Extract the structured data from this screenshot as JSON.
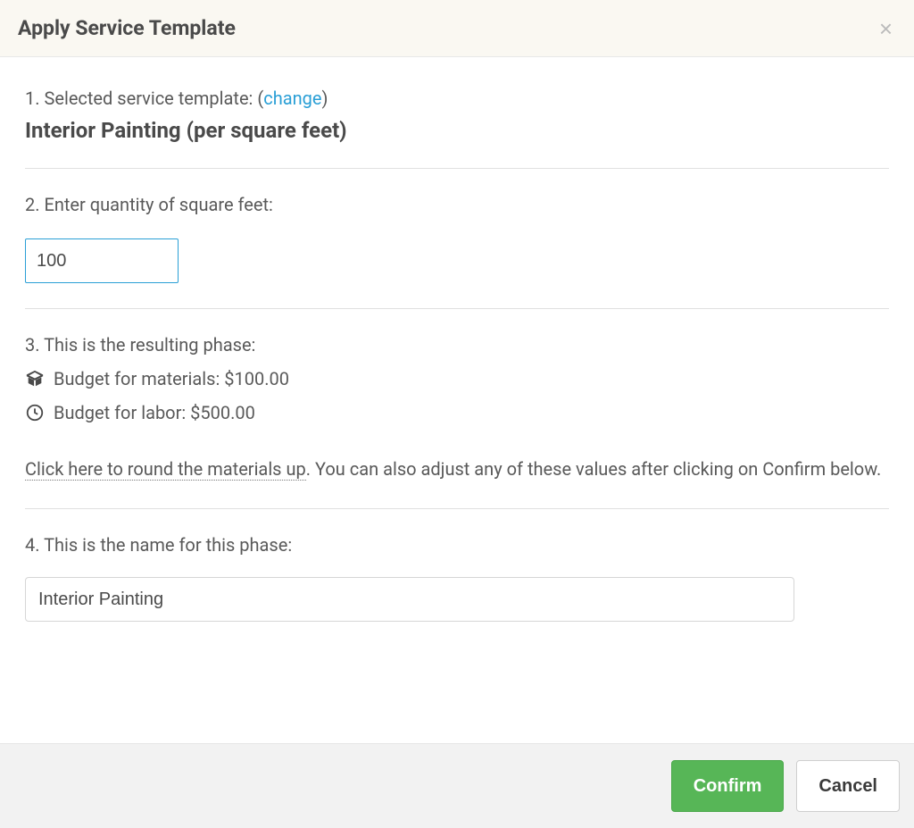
{
  "header": {
    "title": "Apply Service Template"
  },
  "step1": {
    "label_prefix": "1. Selected service template: (",
    "change_label": "change",
    "label_suffix": ")",
    "template_name": "Interior Painting (per square feet)"
  },
  "step2": {
    "label": "2. Enter quantity of square feet:",
    "value": "100"
  },
  "step3": {
    "label": "3. This is the resulting phase:",
    "materials_label": "Budget for materials: ",
    "materials_value": "$100.00",
    "labor_label": "Budget for labor: ",
    "labor_value": "$500.00",
    "round_link": "Click here to round the materials up",
    "round_rest": ". You can also adjust any of these values after clicking on Confirm below."
  },
  "step4": {
    "label": "4. This is the name for this phase:",
    "value": "Interior Painting"
  },
  "footer": {
    "confirm": "Confirm",
    "cancel": "Cancel"
  }
}
